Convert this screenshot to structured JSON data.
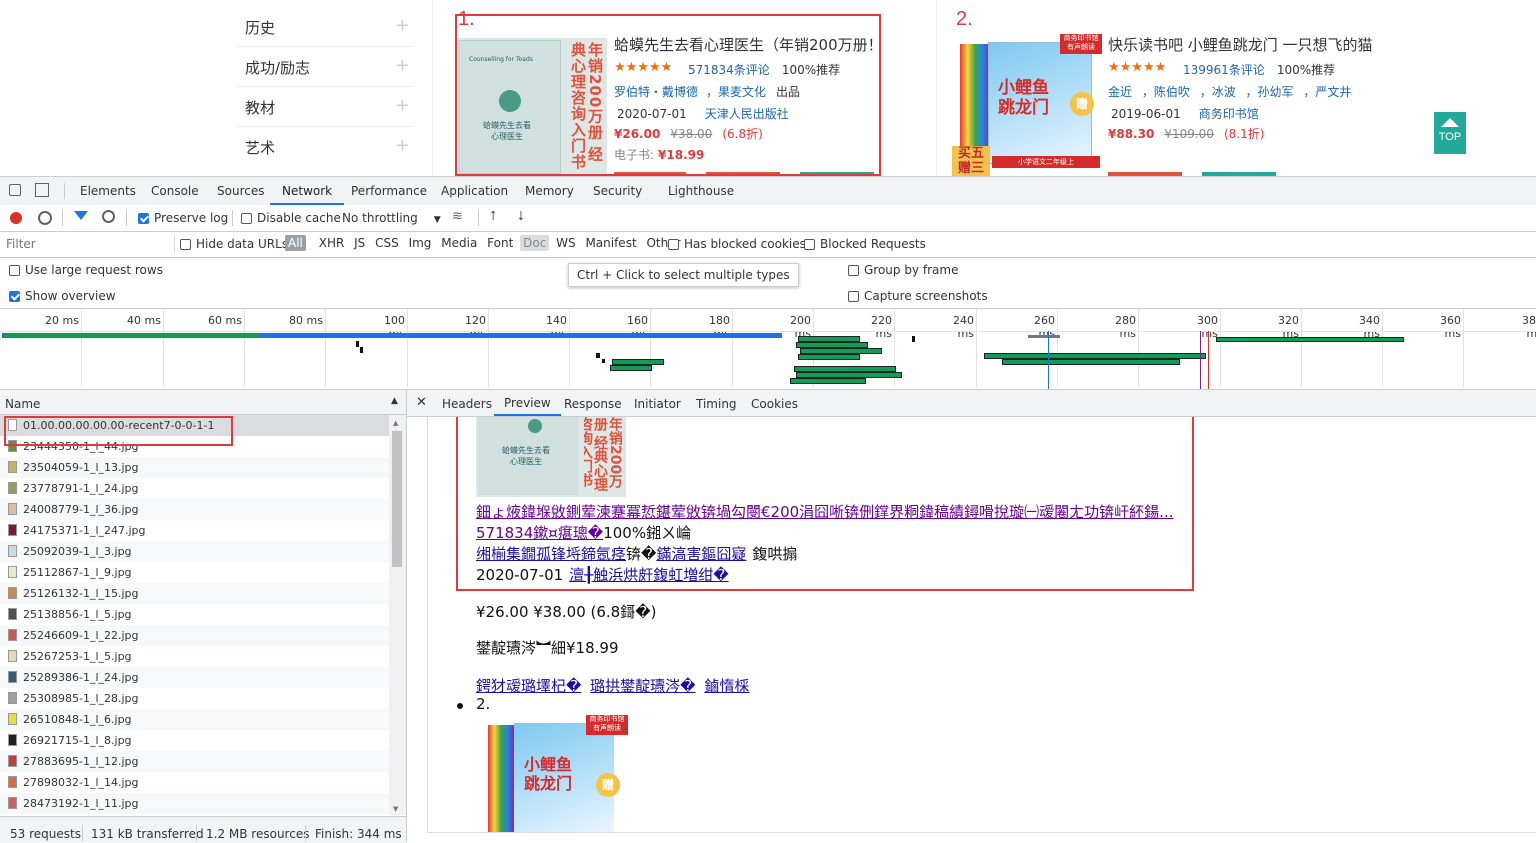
{
  "categories": [
    "历史",
    "成功/励志",
    "教材",
    "艺术"
  ],
  "books": [
    {
      "rank": "1.",
      "title": "蛤蟆先生去看心理医生（年销200万册！",
      "stars": "★★★★★",
      "reviews": "571834条评论",
      "recommend": "100%推荐",
      "authors": "罗伯特・戴博德",
      "publisher_brand": "，果麦文化",
      "role": "出品",
      "date": "2020-07-01",
      "press": "天津人民出版社",
      "price": "¥26.00",
      "orig_price": "¥38.00",
      "discount": "(6.8折)",
      "ebook_label": "电子书:",
      "ebook_price": "¥18.99",
      "cover_side_text": "年销200万册 经典心理咨询入门书",
      "cover_en": "Counselling for Toads",
      "cover_cn": "蛤蟆先生去看心理医生"
    },
    {
      "rank": "2.",
      "title": "快乐读书吧 小鲤鱼跳龙门 一只想飞的猫",
      "stars": "★★★★★",
      "reviews": "139961条评论",
      "recommend": "100%推荐",
      "authors": [
        "金近",
        "，陈伯吹",
        "，冰波",
        "，孙幼军",
        "，严文井"
      ],
      "date": "2019-06-01",
      "press": "商务印书馆",
      "price": "¥88.30",
      "orig_price": "¥109.00",
      "discount": "(8.1折)",
      "badge": "商务印书馆 有声朗读",
      "cover_title": "小鲤鱼跳龙门",
      "gift": "赠",
      "promo": "买五 赠三",
      "grade": "小学语文二年级上"
    }
  ],
  "top_button": "TOP",
  "devtools": {
    "tabs": [
      "Elements",
      "Console",
      "Sources",
      "Network",
      "Performance",
      "Application",
      "Memory",
      "Security",
      "Lighthouse"
    ],
    "active_tab": "Network",
    "toolbar": {
      "preserve_log": "Preserve log",
      "disable_cache": "Disable cache",
      "throttling": "No throttling"
    },
    "filter": {
      "placeholder": "Filter",
      "hide_data_urls": "Hide data URLs",
      "types": [
        "All",
        "XHR",
        "JS",
        "CSS",
        "Img",
        "Media",
        "Font",
        "Doc",
        "WS",
        "Manifest",
        "Other"
      ],
      "has_blocked_cookies": "Has blocked cookies",
      "blocked_requests": "Blocked Requests"
    },
    "options": {
      "large_rows": "Use large request rows",
      "show_overview": "Show overview",
      "group_by_frame": "Group by frame",
      "capture_screenshots": "Capture screenshots",
      "tooltip": "Ctrl + Click to select multiple types"
    },
    "timeline_ticks": [
      "20 ms",
      "40 ms",
      "60 ms",
      "80 ms",
      "100 ms",
      "120 ms",
      "140 ms",
      "160 ms",
      "180 ms",
      "200 ms",
      "220 ms",
      "240 ms",
      "260 ms",
      "280 ms",
      "300 ms",
      "320 ms",
      "340 ms",
      "360 ms",
      "380 ms"
    ],
    "name_header": "Name",
    "requests": [
      "01.00.00.00.00.00-recent7-0-0-1-1",
      "23444350-1_l_44.jpg",
      "23504059-1_l_13.jpg",
      "23778791-1_l_24.jpg",
      "24008779-1_l_36.jpg",
      "24175371-1_l_247.jpg",
      "25092039-1_l_3.jpg",
      "25112867-1_l_9.jpg",
      "25126132-1_l_15.jpg",
      "25138856-1_l_5.jpg",
      "25246609-1_l_22.jpg",
      "25267253-1_l_5.jpg",
      "25289386-1_l_24.jpg",
      "25308985-1_l_28.jpg",
      "26510848-1_l_6.jpg",
      "26921715-1_l_8.jpg",
      "27883695-1_l_12.jpg",
      "27898032-1_l_14.jpg",
      "28473192-1_l_11.jpg"
    ],
    "detail_tabs": [
      "Headers",
      "Preview",
      "Response",
      "Initiator",
      "Timing",
      "Cookies"
    ],
    "active_detail_tab": "Preview",
    "status": {
      "requests": "53 requests",
      "transferred": "131 kB transferred",
      "resources": "1.2 MB resources",
      "finish": "Finish: 344 ms"
    },
    "preview": {
      "garbled_title": "鈿ょ焲鍏堢敓鍘荤湅蹇冪悊鍖荤敓锛堝勾閿€200涓囧唽锛侀鐣界粡鍏稿績鐞嗗挩璇㈠叆闂ㄤ功锛屽紑鍚...",
      "reviews_link": "571834鏉¤瘎璁�",
      "recommend_text": "100%鎺ㄨ崘",
      "authors_link": "缃椾集鐗孤锋埓鍗氬痉",
      "authors_sep": "锛�",
      "brand_link": "鏋滈害鏂囧寲",
      "role_text": "鍑哄搧",
      "date": "2020-07-01",
      "press_link": "澶╂触浜烘皯鍑虹増绀�",
      "price_line": "¥26.00 ¥38.00 (6.8鎶�)",
      "ebook_line": "鐢靛瓙涔︼細¥18.99",
      "links_line": [
        "鍔犲叆璐墿杞�",
        "璐拱鐢靛瓙涔�",
        "鏀惰棌"
      ],
      "item2_label": "2."
    }
  }
}
